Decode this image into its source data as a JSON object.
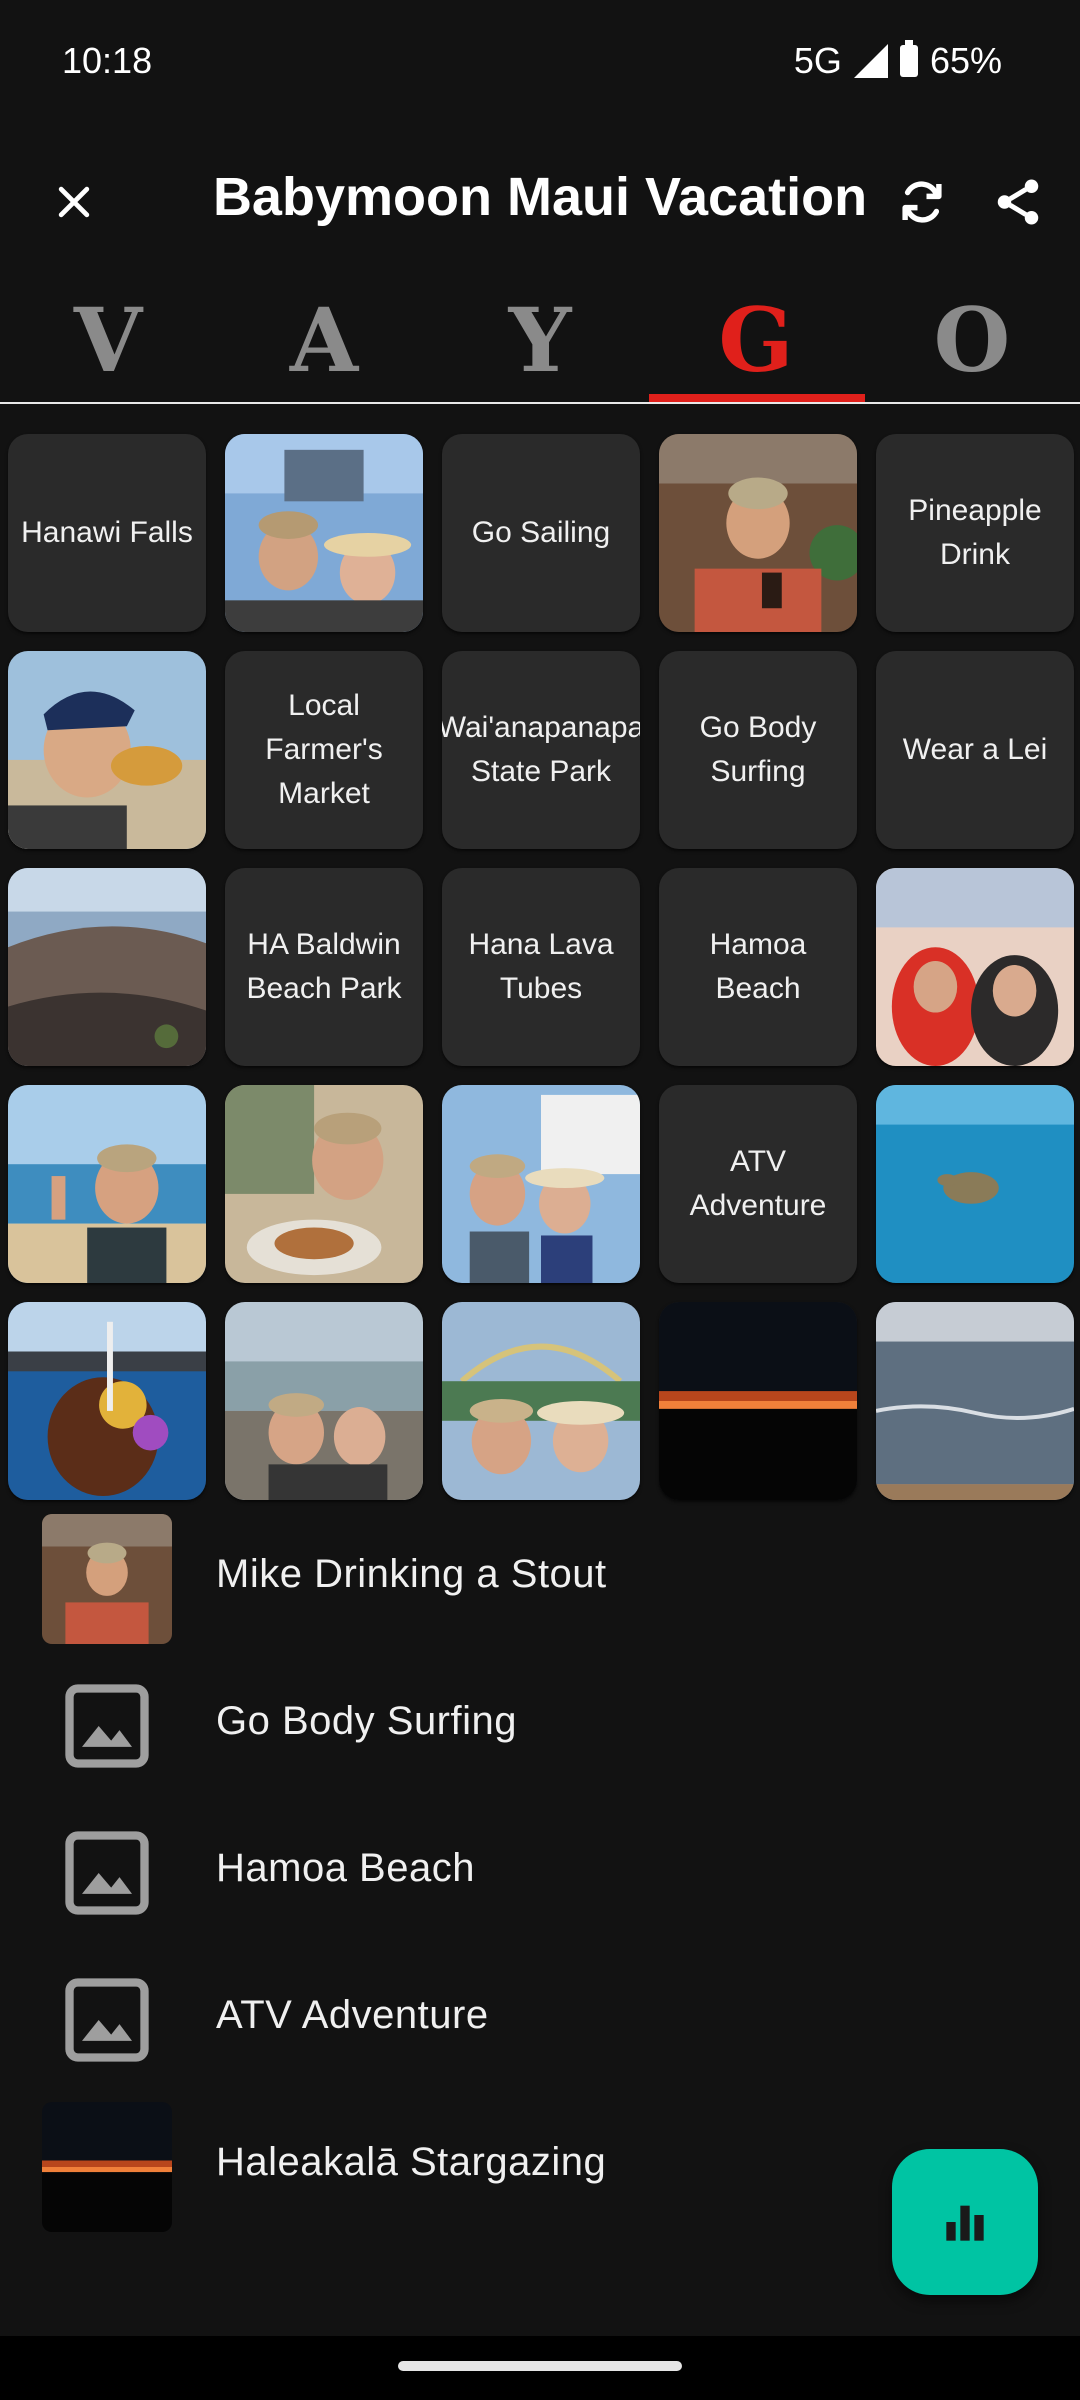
{
  "status": {
    "time": "10:18",
    "network": "5G",
    "battery": "65%"
  },
  "appbar": {
    "title": "Babymoon Maui Vacation",
    "close_icon": "close-icon",
    "sync_icon": "sync-icon",
    "share_icon": "share-icon"
  },
  "tabs": [
    {
      "label": "V",
      "active": false
    },
    {
      "label": "A",
      "active": false
    },
    {
      "label": "Y",
      "active": false
    },
    {
      "label": "G",
      "active": true
    },
    {
      "label": "O",
      "active": false
    }
  ],
  "grid": {
    "tiles": [
      {
        "text": "Hanawi Falls"
      },
      {
        "photo": "selfie-couple-mall"
      },
      {
        "text": "Go Sailing"
      },
      {
        "photo": "man-with-beer"
      },
      {
        "text": "Pineapple Drink"
      },
      {
        "photo": "man-eating-taco"
      },
      {
        "text": "Local Farmer's Market"
      },
      {
        "text": "Wai'anapanapa State Park"
      },
      {
        "text": "Go Body Surfing"
      },
      {
        "text": "Wear a Lei"
      },
      {
        "photo": "volcano-crater"
      },
      {
        "text": "HA Baldwin Beach Park"
      },
      {
        "text": "Hana Lava Tubes"
      },
      {
        "text": "Hamoa Beach"
      },
      {
        "photo": "couple-summit-sunset"
      },
      {
        "photo": "man-beach-shore"
      },
      {
        "photo": "man-eating-dinner"
      },
      {
        "photo": "couple-calypso-boat"
      },
      {
        "text": "ATV Adventure"
      },
      {
        "photo": "turtle-underwater"
      },
      {
        "photo": "tropical-drink-harbor"
      },
      {
        "photo": "couple-rocky-beach"
      },
      {
        "photo": "couple-rainbow"
      },
      {
        "photo": "stargazing-horizon"
      },
      {
        "photo": "ocean-waves"
      }
    ]
  },
  "list": {
    "items": [
      {
        "label": "Mike Drinking a Stout",
        "thumb": "photo"
      },
      {
        "label": "Go Body Surfing",
        "thumb": "placeholder-image-icon"
      },
      {
        "label": "Hamoa Beach",
        "thumb": "placeholder-image-icon"
      },
      {
        "label": "ATV Adventure",
        "thumb": "placeholder-image-icon"
      },
      {
        "label": "Haleakalā Stargazing",
        "thumb": "photo"
      }
    ]
  },
  "fab": {
    "icon": "bar-chart-icon"
  },
  "colors": {
    "accent": "#e0201b",
    "fab": "#00c4a3",
    "background": "#121212",
    "tile": "#2a2a2a"
  }
}
